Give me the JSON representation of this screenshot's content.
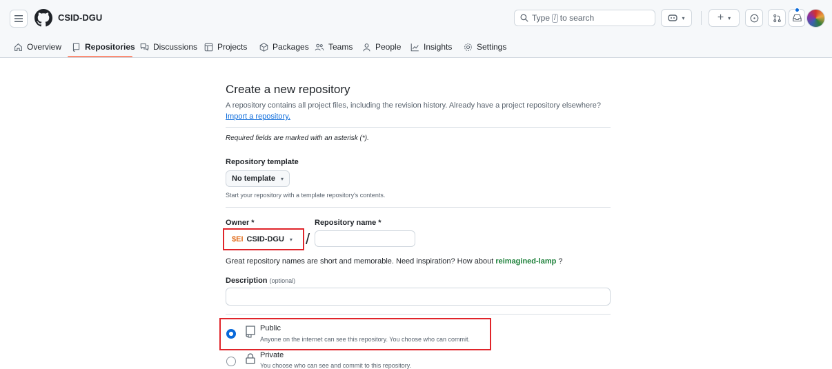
{
  "header": {
    "org_name": "CSID-DGU",
    "search": {
      "prefix": "Type",
      "key": "/",
      "suffix": "to search"
    }
  },
  "nav": {
    "tabs": [
      {
        "label": "Overview",
        "icon": "home-icon"
      },
      {
        "label": "Repositories",
        "icon": "repo-icon",
        "active": true
      },
      {
        "label": "Discussions",
        "icon": "discussions-icon"
      },
      {
        "label": "Projects",
        "icon": "table-icon"
      },
      {
        "label": "Packages",
        "icon": "package-icon"
      },
      {
        "label": "Teams",
        "icon": "people-icon"
      },
      {
        "label": "People",
        "icon": "person-icon"
      },
      {
        "label": "Insights",
        "icon": "graph-icon"
      },
      {
        "label": "Settings",
        "icon": "gear-icon"
      }
    ]
  },
  "form": {
    "title": "Create a new repository",
    "subtitle": "A repository contains all project files, including the revision history. Already have a project repository elsewhere?",
    "import_link": "Import a repository.",
    "required_note": "Required fields are marked with an asterisk (*).",
    "template": {
      "label": "Repository template",
      "selected": "No template",
      "hint": "Start your repository with a template repository's contents."
    },
    "owner": {
      "label": "Owner *",
      "badge": "$EI",
      "selected": "CSID-DGU"
    },
    "repo_name": {
      "label": "Repository name *",
      "value": "",
      "separator": "/"
    },
    "inspiration": {
      "text": "Great repository names are short and memorable. Need inspiration? How about",
      "suggestion": "reimagined-lamp",
      "suffix": "?"
    },
    "description": {
      "label": "Description",
      "optional": "(optional)",
      "value": ""
    },
    "visibility": {
      "public": {
        "title": "Public",
        "desc": "Anyone on the internet can see this repository. You choose who can commit.",
        "checked": true
      },
      "private": {
        "title": "Private",
        "desc": "You choose who can see and commit to this repository.",
        "checked": false
      }
    }
  },
  "colors": {
    "accent": "#0969da",
    "highlight_box": "#e0242a",
    "tab_underline": "#fd8c73",
    "suggestion": "#1a7f37"
  }
}
